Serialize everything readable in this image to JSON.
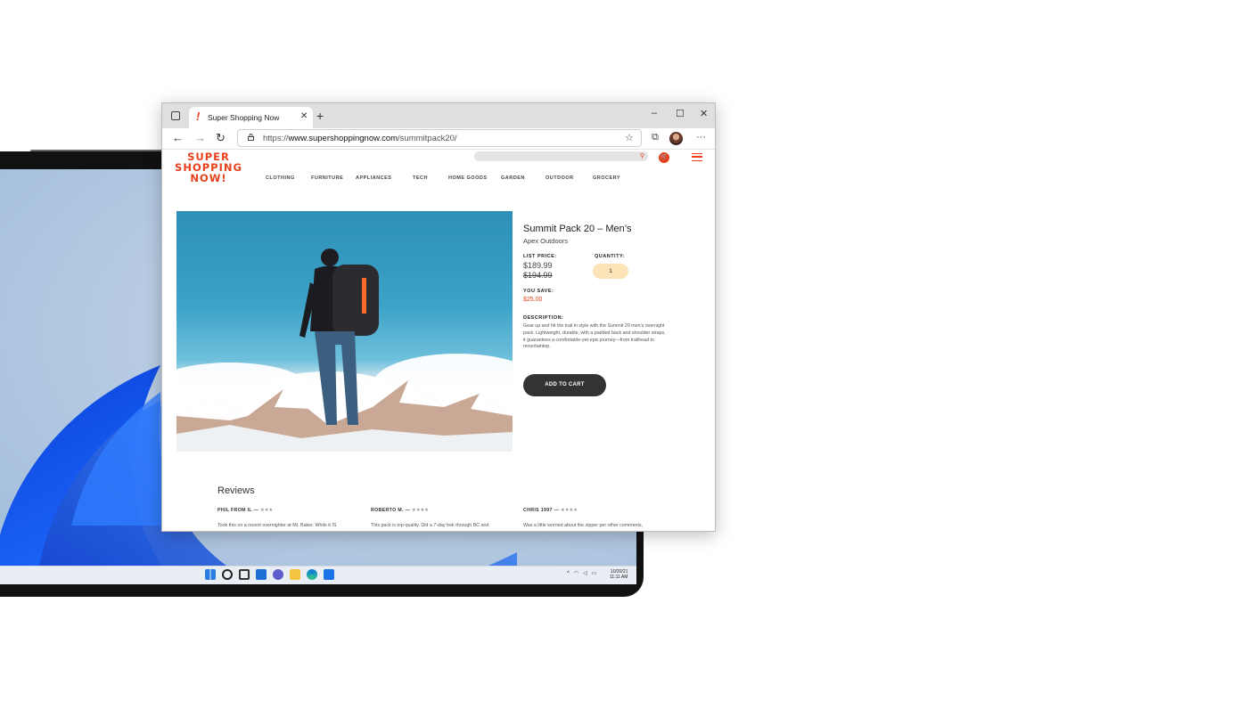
{
  "browser": {
    "tab_title": "Super Shopping Now",
    "tab_favicon": "!",
    "url_prefix": "https://",
    "url_domain": "www.supershoppingnow.com",
    "url_path": "/summitpack20/"
  },
  "site": {
    "logo_lines": [
      "SUPER",
      "SHOPPING",
      "NOW!"
    ],
    "nav": [
      "CLOTHING",
      "FURNITURE",
      "APPLIANCES",
      "TECH",
      "HOME GOODS",
      "GARDEN",
      "OUTDOOR",
      "GROCERY"
    ]
  },
  "product": {
    "title": "Summit Pack 20 – Men’s",
    "brand": "Apex Outdoors",
    "list_price_label": "LIST PRICE:",
    "price": "$189.99",
    "old_price": "$194.99",
    "quantity_label": "QUANTITY:",
    "quantity": "1",
    "you_save_label": "YOU SAVE:",
    "savings": "$25.00",
    "description_label": "DESCRIPTION:",
    "description": "Gear up and hit the trail in style with the Summit 20 men's overnight pack. Lightweight, durable, with a padded back and shoulder straps, it guarantees a comfortable-yet-epic journey—from trailhead to mountaintop.",
    "add_to_cart": "ADD TO CART"
  },
  "reviews": {
    "heading": "Reviews",
    "items": [
      {
        "name": "PHIL FROM IL —",
        "stars": "★★★",
        "text": "Took this on a recent overnighter at Mt. Baker. While it IS"
      },
      {
        "name": "ROBERTO M. —",
        "stars": "★★★★",
        "text": "This pack is top-quality. Did a 7-day trek through BC and"
      },
      {
        "name": "CHRIS 1997 —",
        "stars": "★★★★",
        "text": "Was a little worried about the zipper per other comments,"
      }
    ]
  },
  "taskbar": {
    "date": "10/20/21",
    "time": "11:11 AM"
  },
  "colors": {
    "accent": "#e8401c",
    "button_dark": "#333333",
    "qty_bg": "#fde3b8"
  }
}
